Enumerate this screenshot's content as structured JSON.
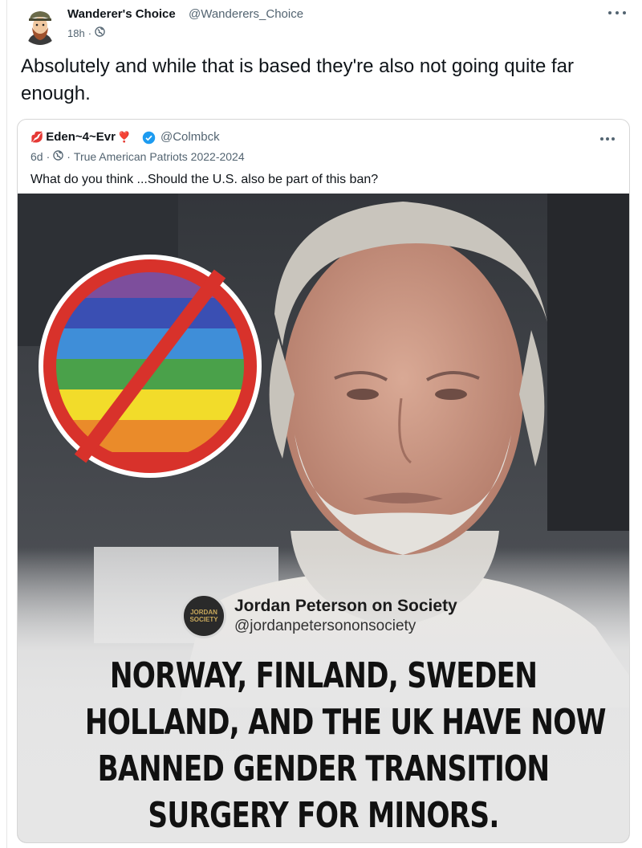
{
  "tweet": {
    "author_name": "Wanderer's Choice",
    "author_handle": "@Wanderers_Choice",
    "time": "18h",
    "meta_separator": "·",
    "text": "Absolutely and while that is based they're also not going quite far enough."
  },
  "quote": {
    "author_name": "Eden~4~Evr",
    "name_emoji_lips": "💋",
    "name_emoji_heart": "❣️",
    "author_handle": "@Colmbck",
    "time": "6d",
    "separator": "·",
    "community": "True American Patriots 2022-2024",
    "text": "What do you think ...Should the U.S. also be part of this ban?",
    "image": {
      "badge_logo_text": "JORDAN SOCIETY",
      "badge_title": "Jordan Peterson on Society",
      "badge_handle": "@jordanpetersononsociety",
      "headline_lines": [
        "NORWAY, FINLAND, SWEDEN",
        "HOLLAND, AND THE UK HAVE NOW",
        "BANNED GENDER TRANSITION",
        "SURGERY FOR MINORS."
      ]
    }
  },
  "icons": {
    "more": "more-horizontal-icon",
    "globe": "globe-icon",
    "verified": "verified-badge-icon",
    "prohibited": "prohibited-rainbow-icon"
  },
  "colors": {
    "text": "#0f1419",
    "secondary": "#536471",
    "verified": "#1d9bf0",
    "prohibit_red": "#d8322b"
  }
}
